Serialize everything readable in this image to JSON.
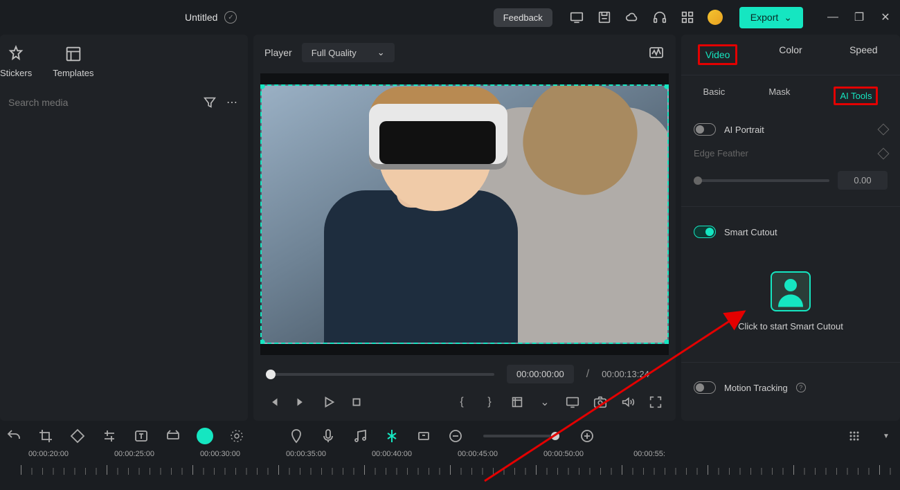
{
  "topbar": {
    "title": "Untitled",
    "feedback": "Feedback",
    "export": "Export"
  },
  "left": {
    "tabs": [
      {
        "label": "Stickers"
      },
      {
        "label": "Templates"
      }
    ],
    "search_placeholder": "Search media"
  },
  "player": {
    "label": "Player",
    "quality": "Full Quality",
    "current_time": "00:00:00:00",
    "separator": "/",
    "total_time": "00:00:13:24"
  },
  "right": {
    "tabs": {
      "video": "Video",
      "color": "Color",
      "speed": "Speed"
    },
    "subtabs": {
      "basic": "Basic",
      "mask": "Mask",
      "aitools": "AI Tools"
    },
    "ai_portrait": "AI Portrait",
    "edge_feather": "Edge Feather",
    "edge_value": "0.00",
    "smart_cutout": "Smart Cutout",
    "cutout_cta": "Click to start Smart Cutout",
    "motion_tracking": "Motion Tracking"
  },
  "timeline": {
    "labels": [
      "00:00:20:00",
      "00:00:25:00",
      "00:00:30:00",
      "00:00:35:00",
      "00:00:40:00",
      "00:00:45:00",
      "00:00:50:00",
      "00:00:55:"
    ]
  }
}
